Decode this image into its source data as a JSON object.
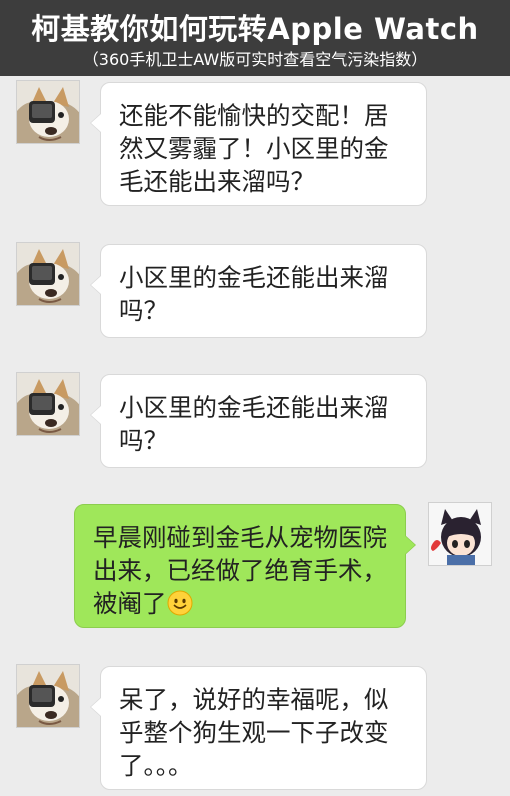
{
  "header": {
    "title": "柯基教你如何玩转Apple Watch",
    "subtitle": "（360手机卫士AW版可实时查看空气污染指数）"
  },
  "messages": [
    {
      "side": "left",
      "avatar": "dog-avatar-icon",
      "text": "还能不能愉快的交配！居然又雾霾了！小区里的金毛还能出来溜吗？"
    },
    {
      "side": "left",
      "avatar": "dog-avatar-icon",
      "text": "小区里的金毛还能出来溜吗？"
    },
    {
      "side": "left",
      "avatar": "dog-avatar-icon",
      "text": "小区里的金毛还能出来溜吗？"
    },
    {
      "side": "right",
      "avatar": "anime-cat-avatar-icon",
      "text": "早晨刚碰到金毛从宠物医院出来，已经做了绝育手术，被阉了",
      "emoji": "smiley-emoji-icon"
    },
    {
      "side": "left",
      "avatar": "dog-avatar-icon",
      "text": "呆了，说好的幸福呢，似乎整个狗生观一下子改变了。。。"
    }
  ],
  "colors": {
    "header_bg": "#3d3d3d",
    "chat_bg": "#ececec",
    "incoming_bubble": "#ffffff",
    "outgoing_bubble": "#9fe75a"
  }
}
